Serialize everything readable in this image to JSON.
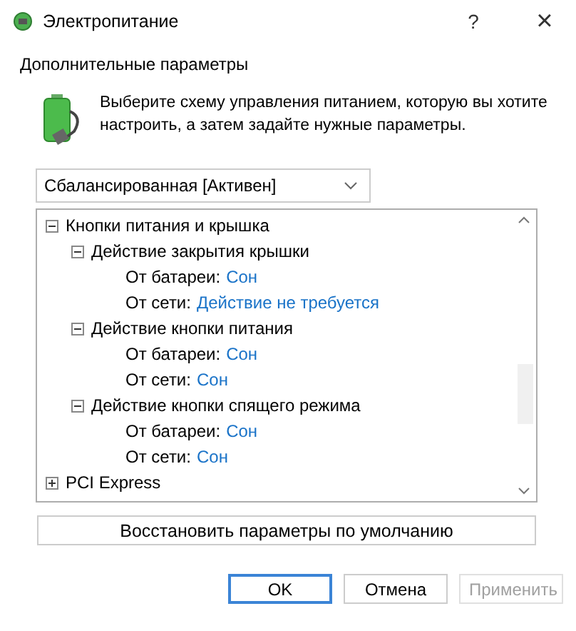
{
  "window": {
    "title": "Электропитание",
    "help": "?",
    "close": "×"
  },
  "section_title": "Дополнительные параметры",
  "description": "Выберите схему управления питанием, которую вы хотите настроить, а затем задайте нужные параметры.",
  "plan_dropdown": {
    "value": "Сбалансированная [Активен]"
  },
  "tree": [
    {
      "kind": "group",
      "label": "Кнопки питания и крышка",
      "expanded": true,
      "children": [
        {
          "kind": "group",
          "label": "Действие закрытия крышки",
          "expanded": true,
          "children": [
            {
              "kind": "setting",
              "label": "От батареи:",
              "value": "Сон"
            },
            {
              "kind": "setting",
              "label": "От сети:",
              "value": "Действие не требуется"
            }
          ]
        },
        {
          "kind": "group",
          "label": "Действие кнопки питания",
          "expanded": true,
          "children": [
            {
              "kind": "setting",
              "label": "От батареи:",
              "value": "Сон"
            },
            {
              "kind": "setting",
              "label": "От сети:",
              "value": "Сон"
            }
          ]
        },
        {
          "kind": "group",
          "label": "Действие кнопки спящего режима",
          "expanded": true,
          "children": [
            {
              "kind": "setting",
              "label": "От батареи:",
              "value": "Сон"
            },
            {
              "kind": "setting",
              "label": "От сети:",
              "value": "Сон"
            }
          ]
        }
      ]
    },
    {
      "kind": "group",
      "label": "PCI Express",
      "expanded": false
    }
  ],
  "restore_button": "Восстановить параметры по умолчанию",
  "buttons": [
    {
      "label": "OK",
      "default": true,
      "disabled": false
    },
    {
      "label": "Отмена",
      "default": false,
      "disabled": false
    },
    {
      "label": "Применить",
      "default": false,
      "disabled": true
    }
  ]
}
